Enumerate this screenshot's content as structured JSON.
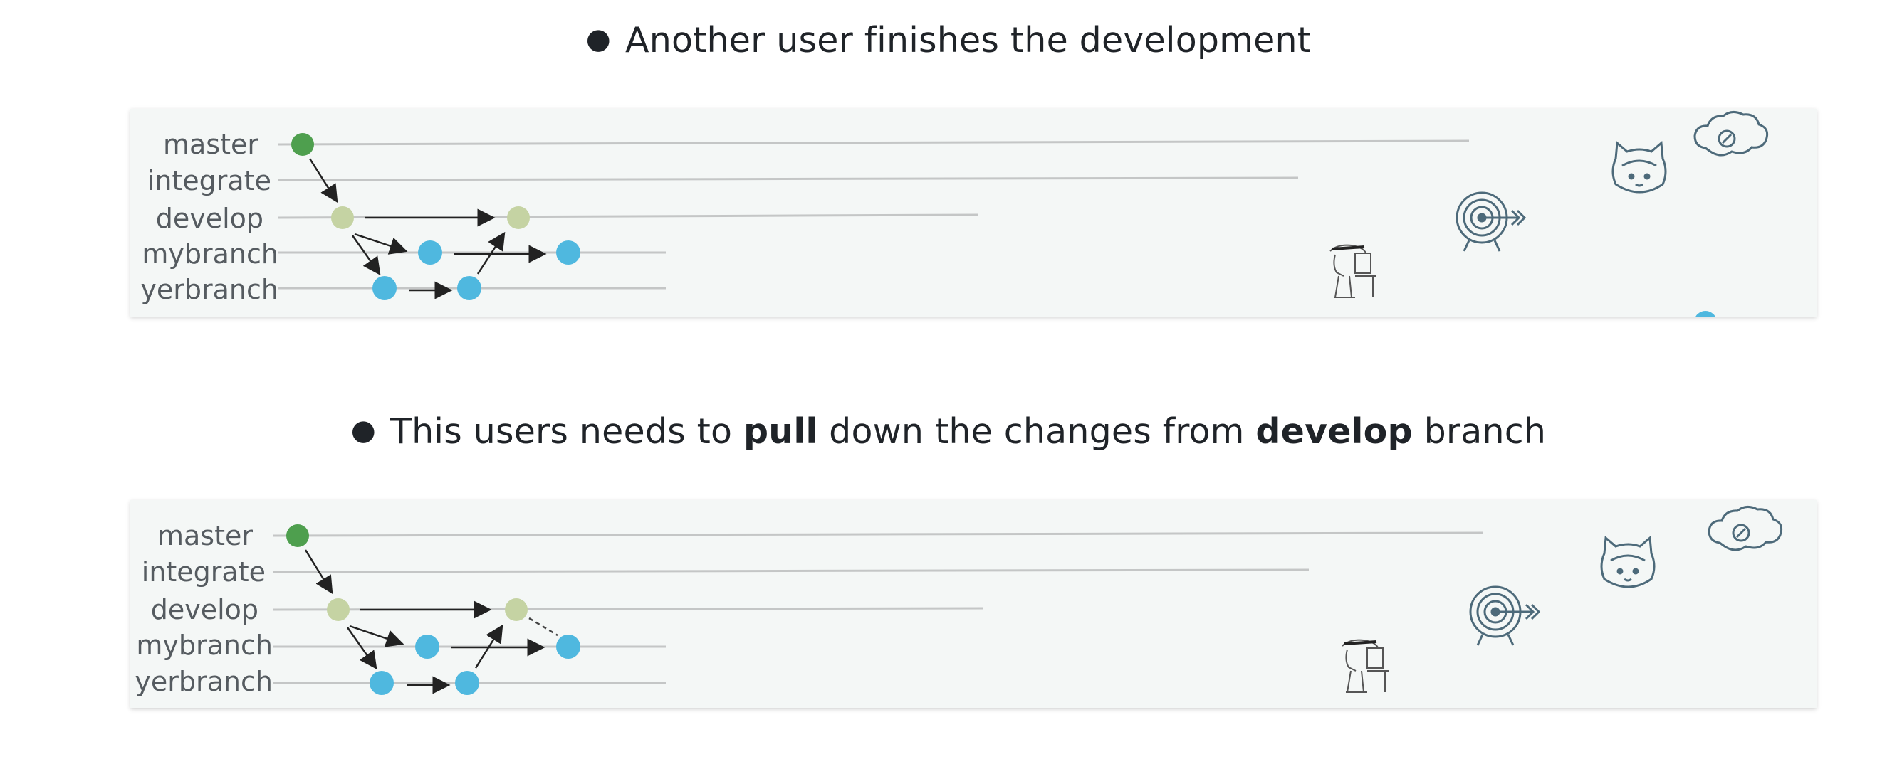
{
  "slides": [
    {
      "bullet": {
        "pre": "Another user finishes the development",
        "b1": "",
        "mid": "",
        "b2": "",
        "post": ""
      },
      "branches": [
        "master",
        "integrate",
        "develop",
        "mybranch",
        "yerbranch"
      ]
    },
    {
      "bullet": {
        "pre": "This users needs to ",
        "b1": "pull",
        "mid": " down the changes from ",
        "b2": "develop",
        "post": " branch"
      },
      "branches": [
        "master",
        "integrate",
        "develop",
        "mybranch",
        "yerbranch"
      ]
    }
  ],
  "colors": {
    "master_commit": "#4e9f4e",
    "develop_commit": "#c5d3a3",
    "feature_commit": "#4fb8df",
    "branch_line": "#c4c6c6",
    "panel_bg": "#f4f7f6",
    "icon_stroke": "#4d6a7a"
  },
  "icons": [
    "developer-sketch-icon",
    "target-icon",
    "octocat-mascot-icon",
    "cloud-icon"
  ]
}
